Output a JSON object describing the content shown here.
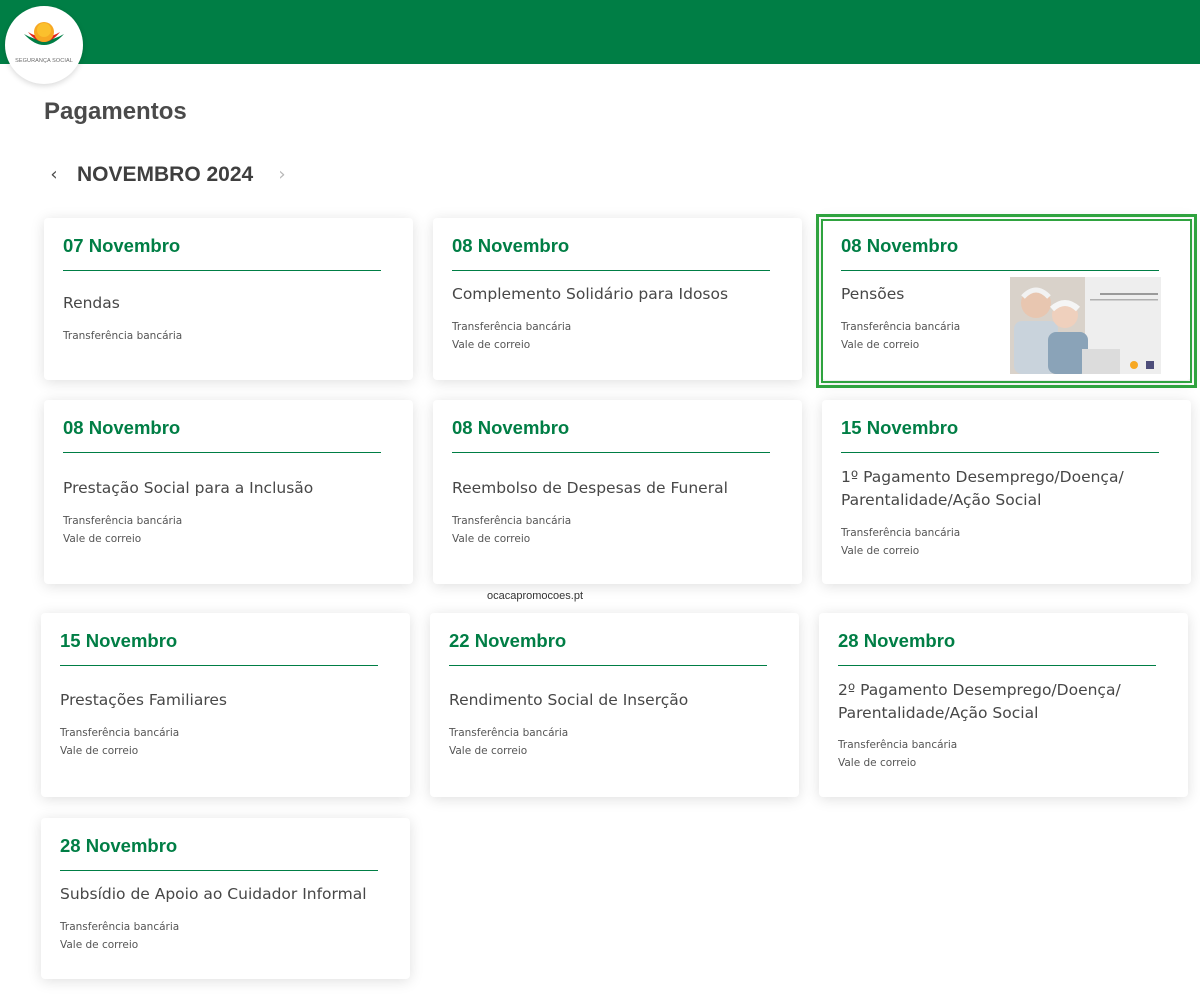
{
  "brand": {
    "logo_text": "SEGURANÇA SOCIAL",
    "colors": {
      "primary": "#007e45",
      "highlight": "#2fa33f",
      "text": "#4a4a4a"
    }
  },
  "page": {
    "title": "Pagamentos"
  },
  "month_nav": {
    "prev_icon": "chevron-left-icon",
    "next_icon": "chevron-right-icon",
    "prev_glyph": "‹",
    "next_glyph": "›",
    "label": "NOVEMBRO 2024"
  },
  "cards": [
    {
      "date": "07 Novembro",
      "title": "Rendas",
      "methods": [
        "Transferência bancária"
      ]
    },
    {
      "date": "08 Novembro",
      "title": "Complemento Solidário para Idosos",
      "methods": [
        "Transferência bancária",
        "Vale de correio"
      ]
    },
    {
      "date": "08 Novembro",
      "title": "Pensões",
      "methods": [
        "Transferência bancária",
        "Vale de correio"
      ]
    },
    {
      "date": "08 Novembro",
      "title": "Prestação Social para a Inclusão",
      "methods": [
        "Transferência bancária",
        "Vale de correio"
      ]
    },
    {
      "date": "08 Novembro",
      "title": "Reembolso de Despesas de Funeral",
      "methods": [
        "Transferência bancária",
        "Vale de correio"
      ]
    },
    {
      "date": "15 Novembro",
      "title": "1º Pagamento Desemprego/Doença/ Parentalidade/Ação Social",
      "methods": [
        "Transferência bancária",
        "Vale de correio"
      ]
    },
    {
      "date": "15 Novembro",
      "title": "Prestações Familiares",
      "methods": [
        "Transferência bancária",
        "Vale de correio"
      ]
    },
    {
      "date": "22 Novembro",
      "title": "Rendimento Social de Inserção",
      "methods": [
        "Transferência bancária",
        "Vale de correio"
      ]
    },
    {
      "date": "28 Novembro",
      "title": "2º Pagamento Desemprego/Doença/ Parentalidade/Ação Social",
      "methods": [
        "Transferência bancária",
        "Vale de correio"
      ]
    },
    {
      "date": "28 Novembro",
      "title": "Subsídio de Apoio ao Cuidador Informal",
      "methods": [
        "Transferência bancária",
        "Vale de correio"
      ]
    }
  ],
  "watermark": "ocacapromocoes.pt"
}
